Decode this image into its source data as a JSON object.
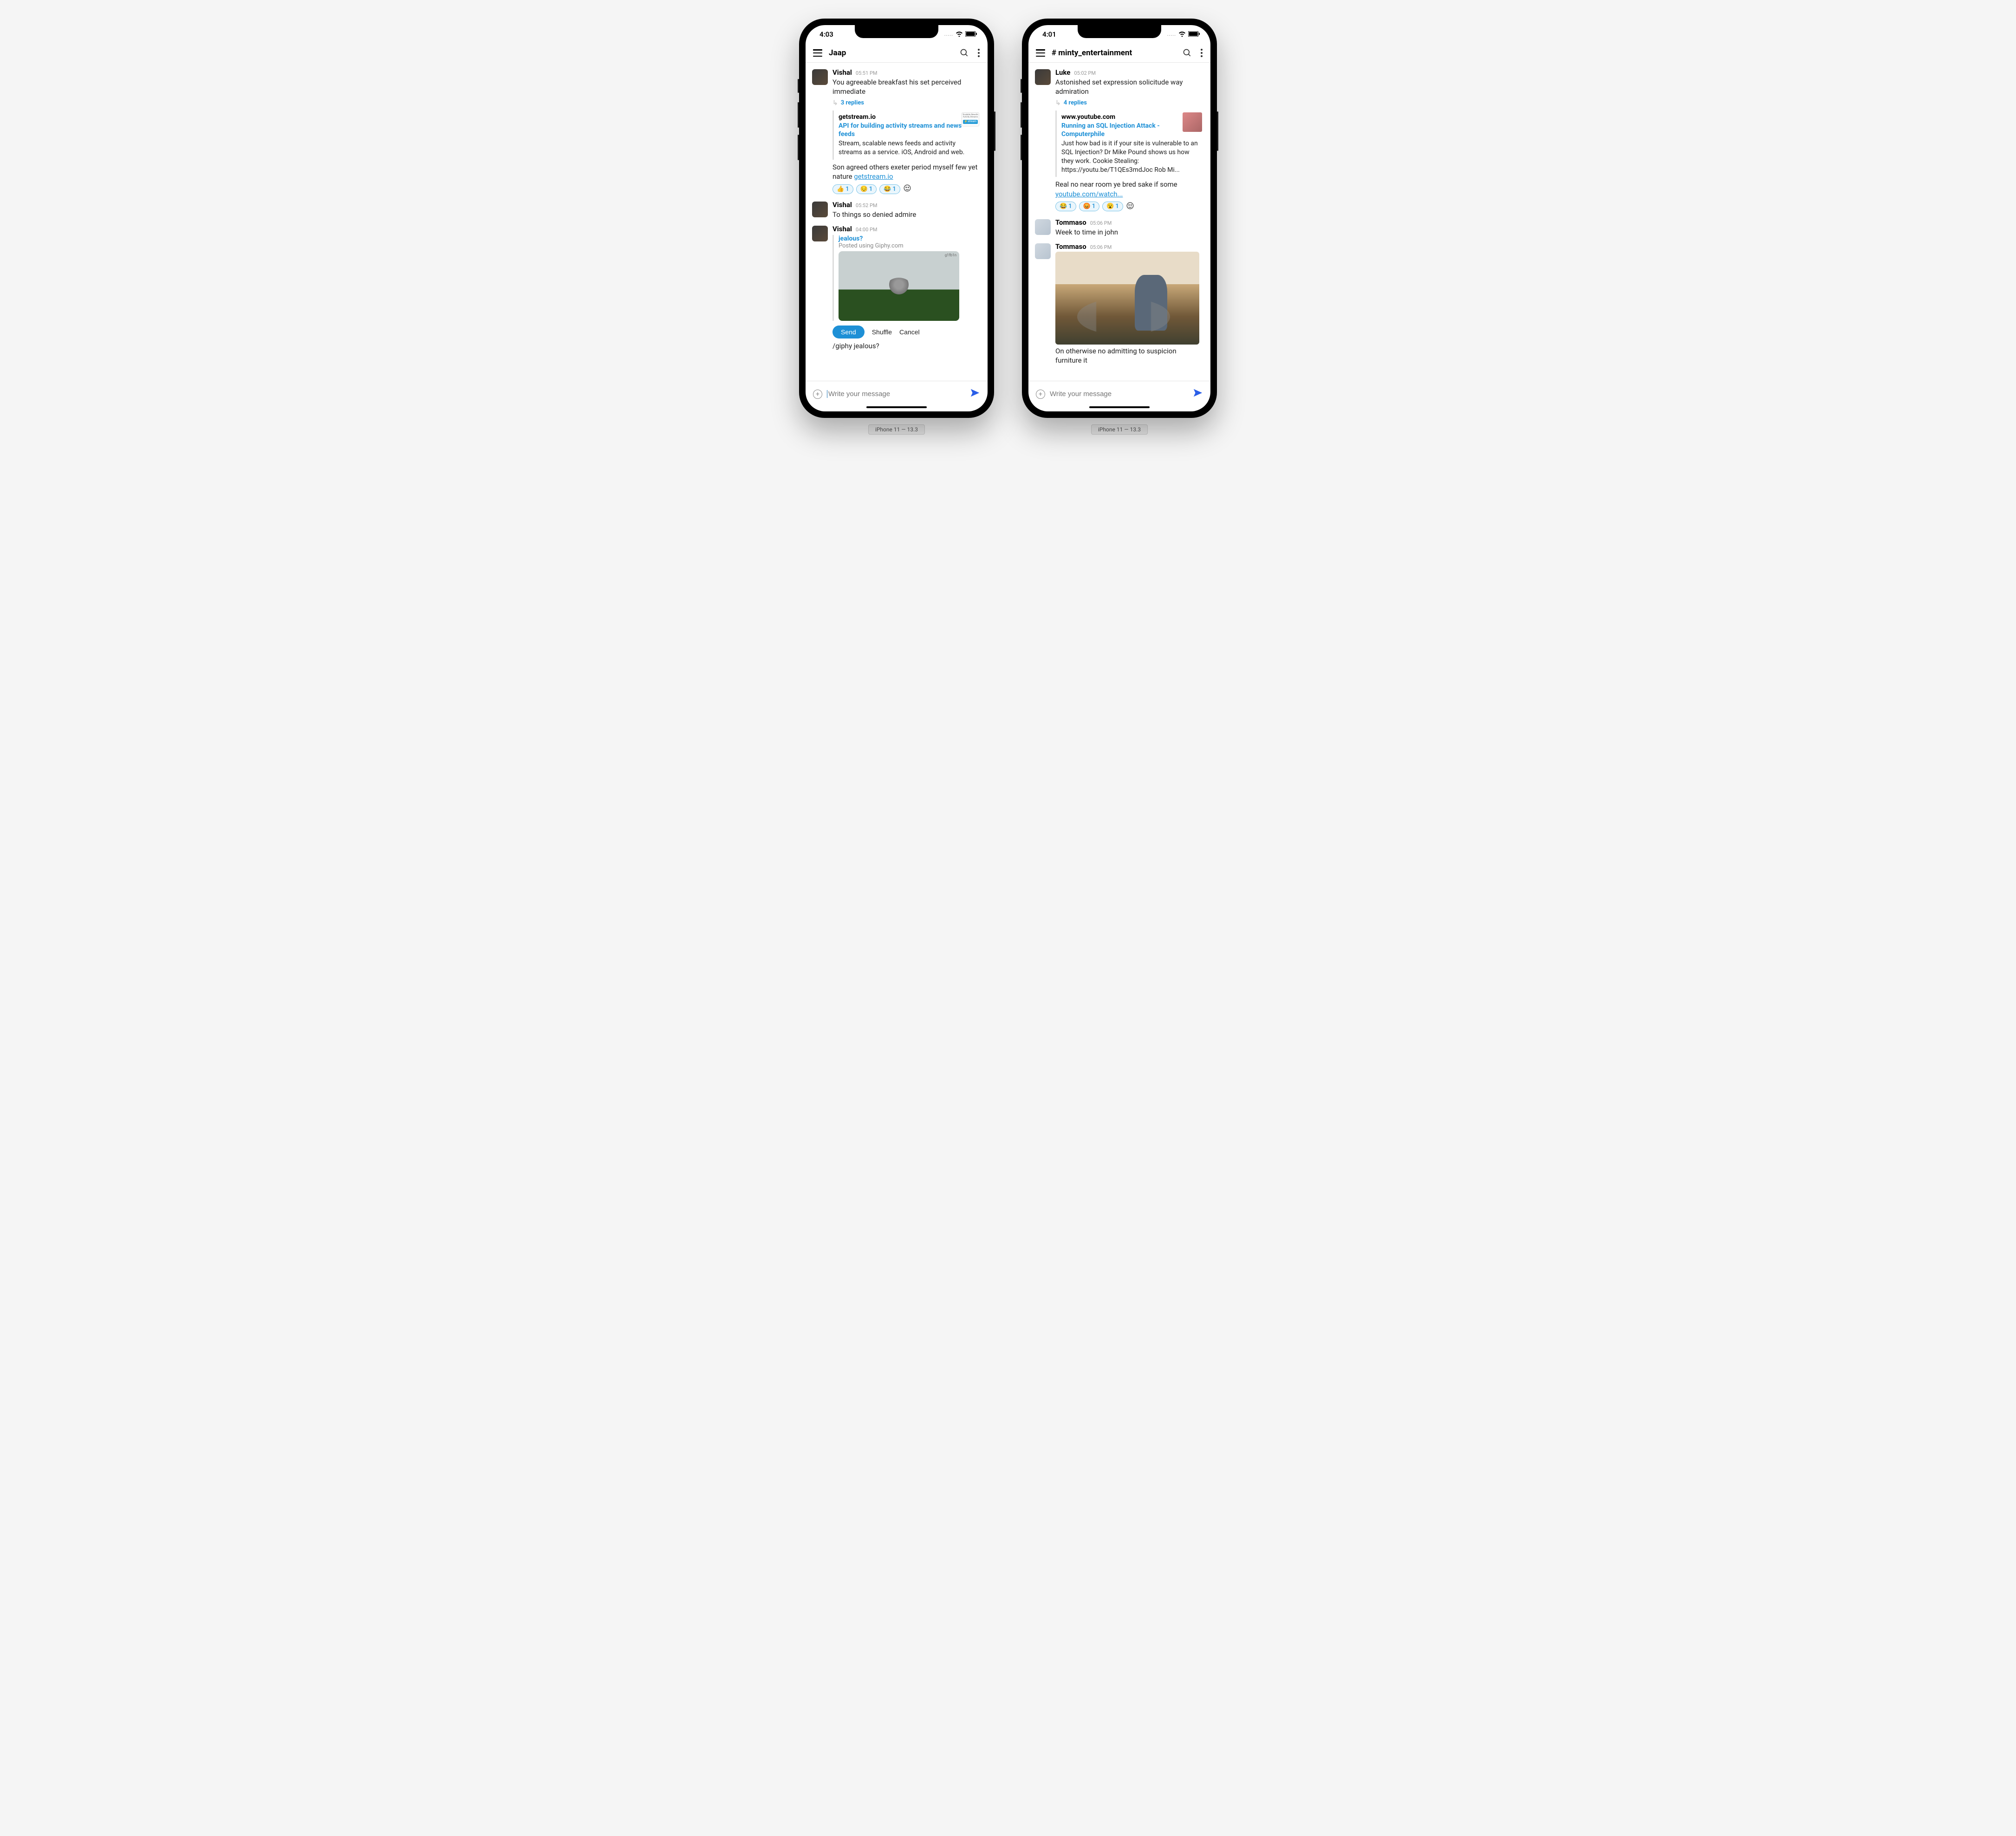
{
  "device_label": "iPhone 11 — 13.3",
  "phones": [
    {
      "status": {
        "time": "4:03",
        "dots": "....."
      },
      "header": {
        "title": "Jaap"
      },
      "composer": {
        "placeholder": "Write your message",
        "focused": true
      },
      "messages": [
        {
          "avatar": "dark",
          "name": "Vishal",
          "time": "05:51 PM",
          "text": "You agreeable breakfast his set perceived immediate",
          "replies": "3 replies",
          "card": {
            "domain": "getstream.io",
            "title": "API for building activity streams and news feeds",
            "desc": "Stream, scalable news feeds and activity streams as a service. iOS, Android and web.",
            "thumb": "stream"
          },
          "text_after": "Son agreed others exeter period myself few yet nature ",
          "text_after_link": "getstream.io",
          "reactions": [
            {
              "emoji": "👍",
              "count": "1"
            },
            {
              "emoji": "😔",
              "count": "1"
            },
            {
              "emoji": "😂",
              "count": "1"
            }
          ]
        },
        {
          "avatar": "dark",
          "name": "Vishal",
          "time": "05:52 PM",
          "text": "To things so denied admire"
        },
        {
          "avatar": "dark",
          "name": "Vishal",
          "time": "04:00 PM",
          "giphy": {
            "title": "jealous?",
            "sub": "Posted using Giphy.com",
            "badge": "g1fb1n",
            "send": "Send",
            "shuffle": "Shuffle",
            "cancel": "Cancel"
          },
          "text_after_plain": "/giphy jealous?"
        }
      ]
    },
    {
      "status": {
        "time": "4:01",
        "dots": "....."
      },
      "header": {
        "title": "# minty_entertainment"
      },
      "composer": {
        "placeholder": "Write your message",
        "focused": false
      },
      "messages": [
        {
          "avatar": "dark",
          "name": "Luke",
          "time": "05:02 PM",
          "text": "Astonished set expression solicitude way admiration",
          "replies": "4 replies",
          "card": {
            "domain": "www.youtube.com",
            "title": "Running an SQL Injection Attack - Computerphile",
            "desc": "Just how bad is it if your site is vulnerable to an SQL Injection? Dr Mike Pound shows us how they work. Cookie Stealing: https://youtu.be/T1QEs3mdJoc Rob Mi...",
            "thumb": "yt"
          },
          "text_after": "Real no near room ye bred sake if some ",
          "text_after_link": "youtube.com/watch...",
          "reactions": [
            {
              "emoji": "😂",
              "count": "1"
            },
            {
              "emoji": "😡",
              "count": "1"
            },
            {
              "emoji": "😮",
              "count": "1"
            }
          ]
        },
        {
          "avatar": "light",
          "name": "Tommaso",
          "time": "05:06 PM",
          "text": "Week to time in john"
        },
        {
          "avatar": "light",
          "name": "Tommaso",
          "time": "05:06 PM",
          "image": true,
          "text_after_plain": "On otherwise no admitting to suspicion furniture it"
        }
      ]
    }
  ]
}
